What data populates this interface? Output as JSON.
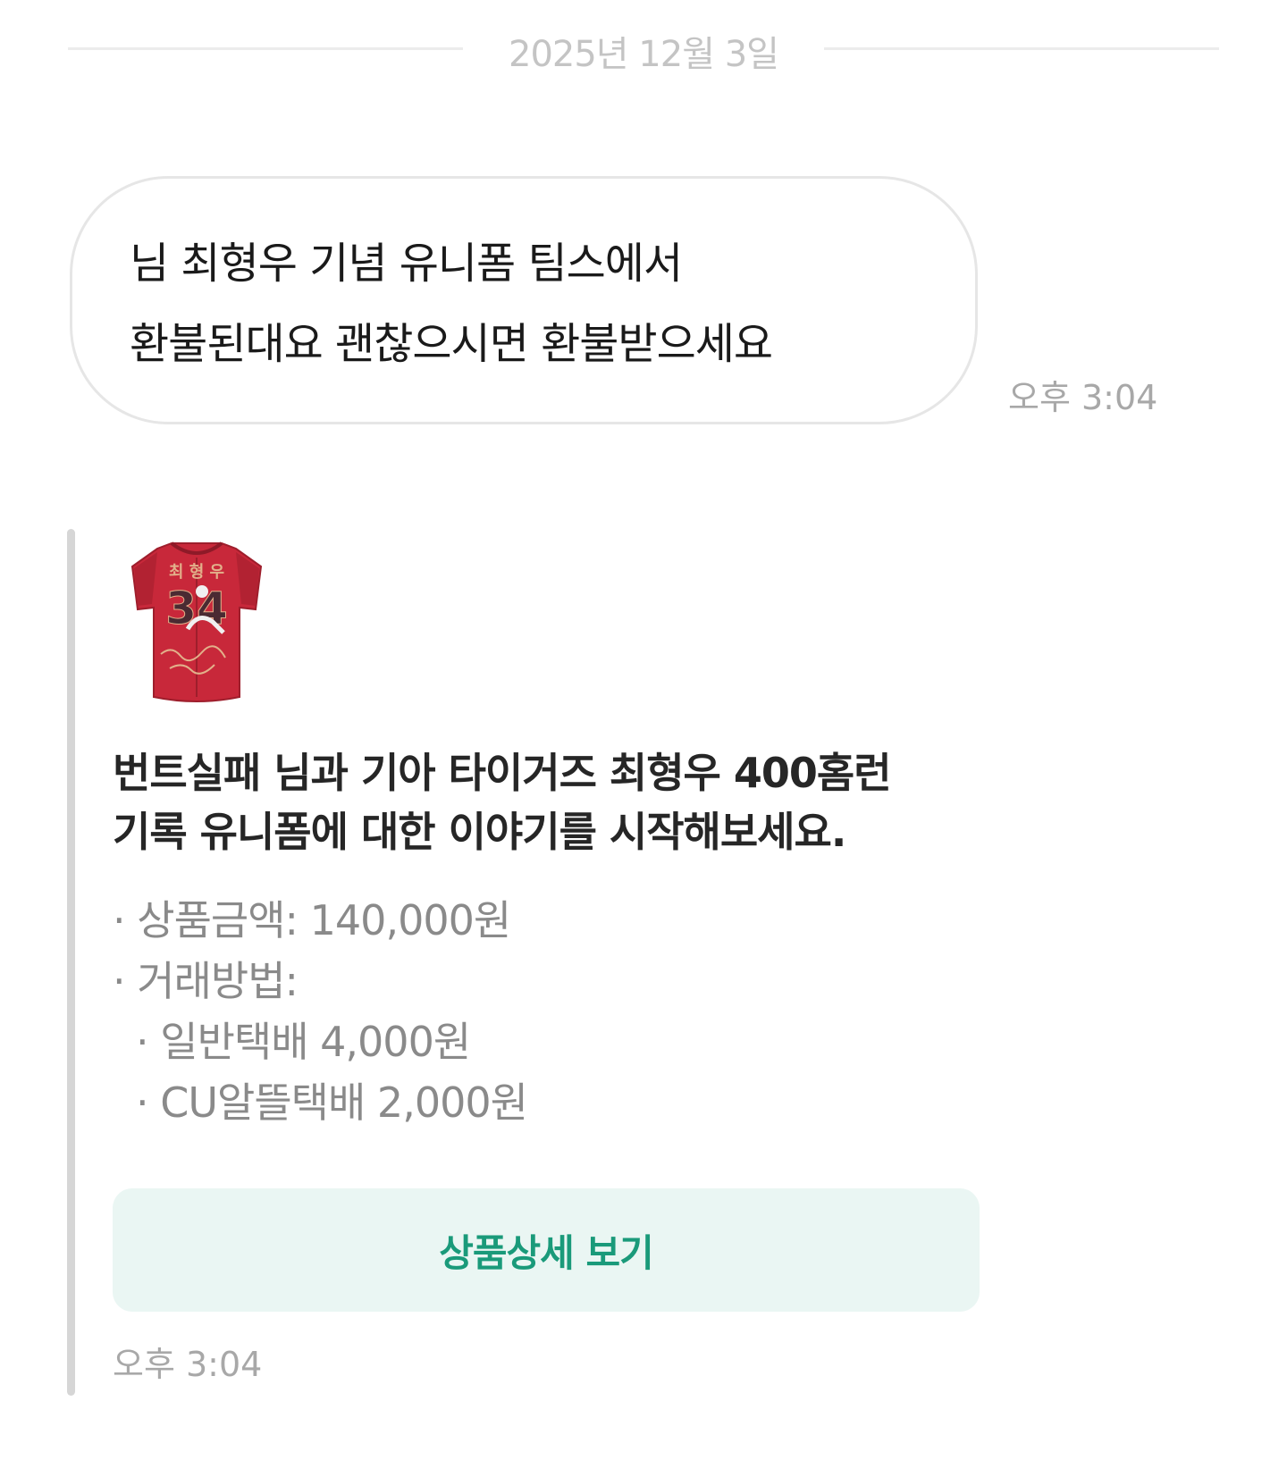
{
  "date_divider": "2025년 12월 3일",
  "incoming_message": {
    "lines": [
      "님 최형우 기념 유니폼 팀스에서",
      "환불된대요 괜찮으시면 환불받으세요"
    ],
    "time": "오후 3:04"
  },
  "product_card": {
    "thumbnail": {
      "icon": "red-baseball-jersey-image",
      "jersey_name": "최 형 우",
      "jersey_number": "34",
      "colors": {
        "jersey": "#c8283a",
        "number": "#4a2a32",
        "trim": "#e2b08a"
      }
    },
    "title_lines": [
      "번트실패 님과 기아 타이거즈 최형우 400홈런",
      "기록 유니폼에 대한 이야기를 시작해보세요."
    ],
    "details": {
      "price": "· 상품금액: 140,000원",
      "trade_method": "· 거래방법:",
      "shipping_options": [
        "· 일반택배 4,000원",
        "· CU알뜰택배 2,000원"
      ]
    },
    "button_label": "상품상세 보기",
    "time": "오후 3:04"
  },
  "colors": {
    "accent": "#1a9a7a",
    "button_bg": "#eaf6f3",
    "muted_text": "#8a8a8a",
    "timestamp": "#a8a8a8"
  }
}
